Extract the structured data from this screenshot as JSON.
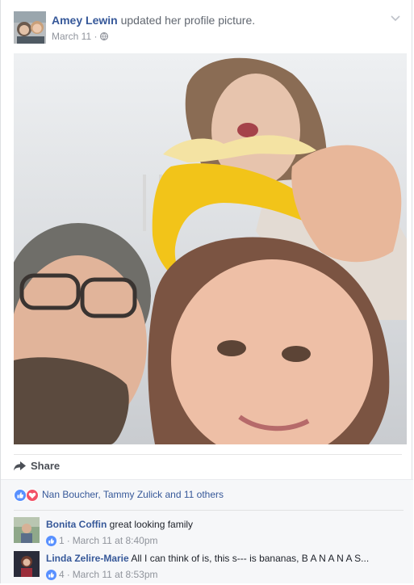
{
  "post": {
    "author": "Amey Lewin",
    "action": "updated her profile picture.",
    "date": "March 11",
    "separator": "·"
  },
  "share": {
    "label": "Share"
  },
  "reactions": {
    "summary": "Nan Boucher, Tammy Zulick and 11 others"
  },
  "comments": [
    {
      "author": "Bonita Coffin",
      "text": "great looking family",
      "likes": "1",
      "dot": "·",
      "timestamp": "March 11 at 8:40pm"
    },
    {
      "author": "Linda Zelire-Marie",
      "text": "All I can think of is, this s--- is bananas, B A N A N A S...",
      "likes": "4",
      "dot": "·",
      "timestamp": "March 11 at 8:53pm"
    }
  ],
  "colors": {
    "link": "#365899",
    "like_blue": "#5890ff",
    "love_red": "#f25268",
    "muted": "#90949c"
  },
  "icons": [
    "chevron-down-icon",
    "globe-icon",
    "share-arrow-icon",
    "like-reaction-icon",
    "love-reaction-icon"
  ]
}
